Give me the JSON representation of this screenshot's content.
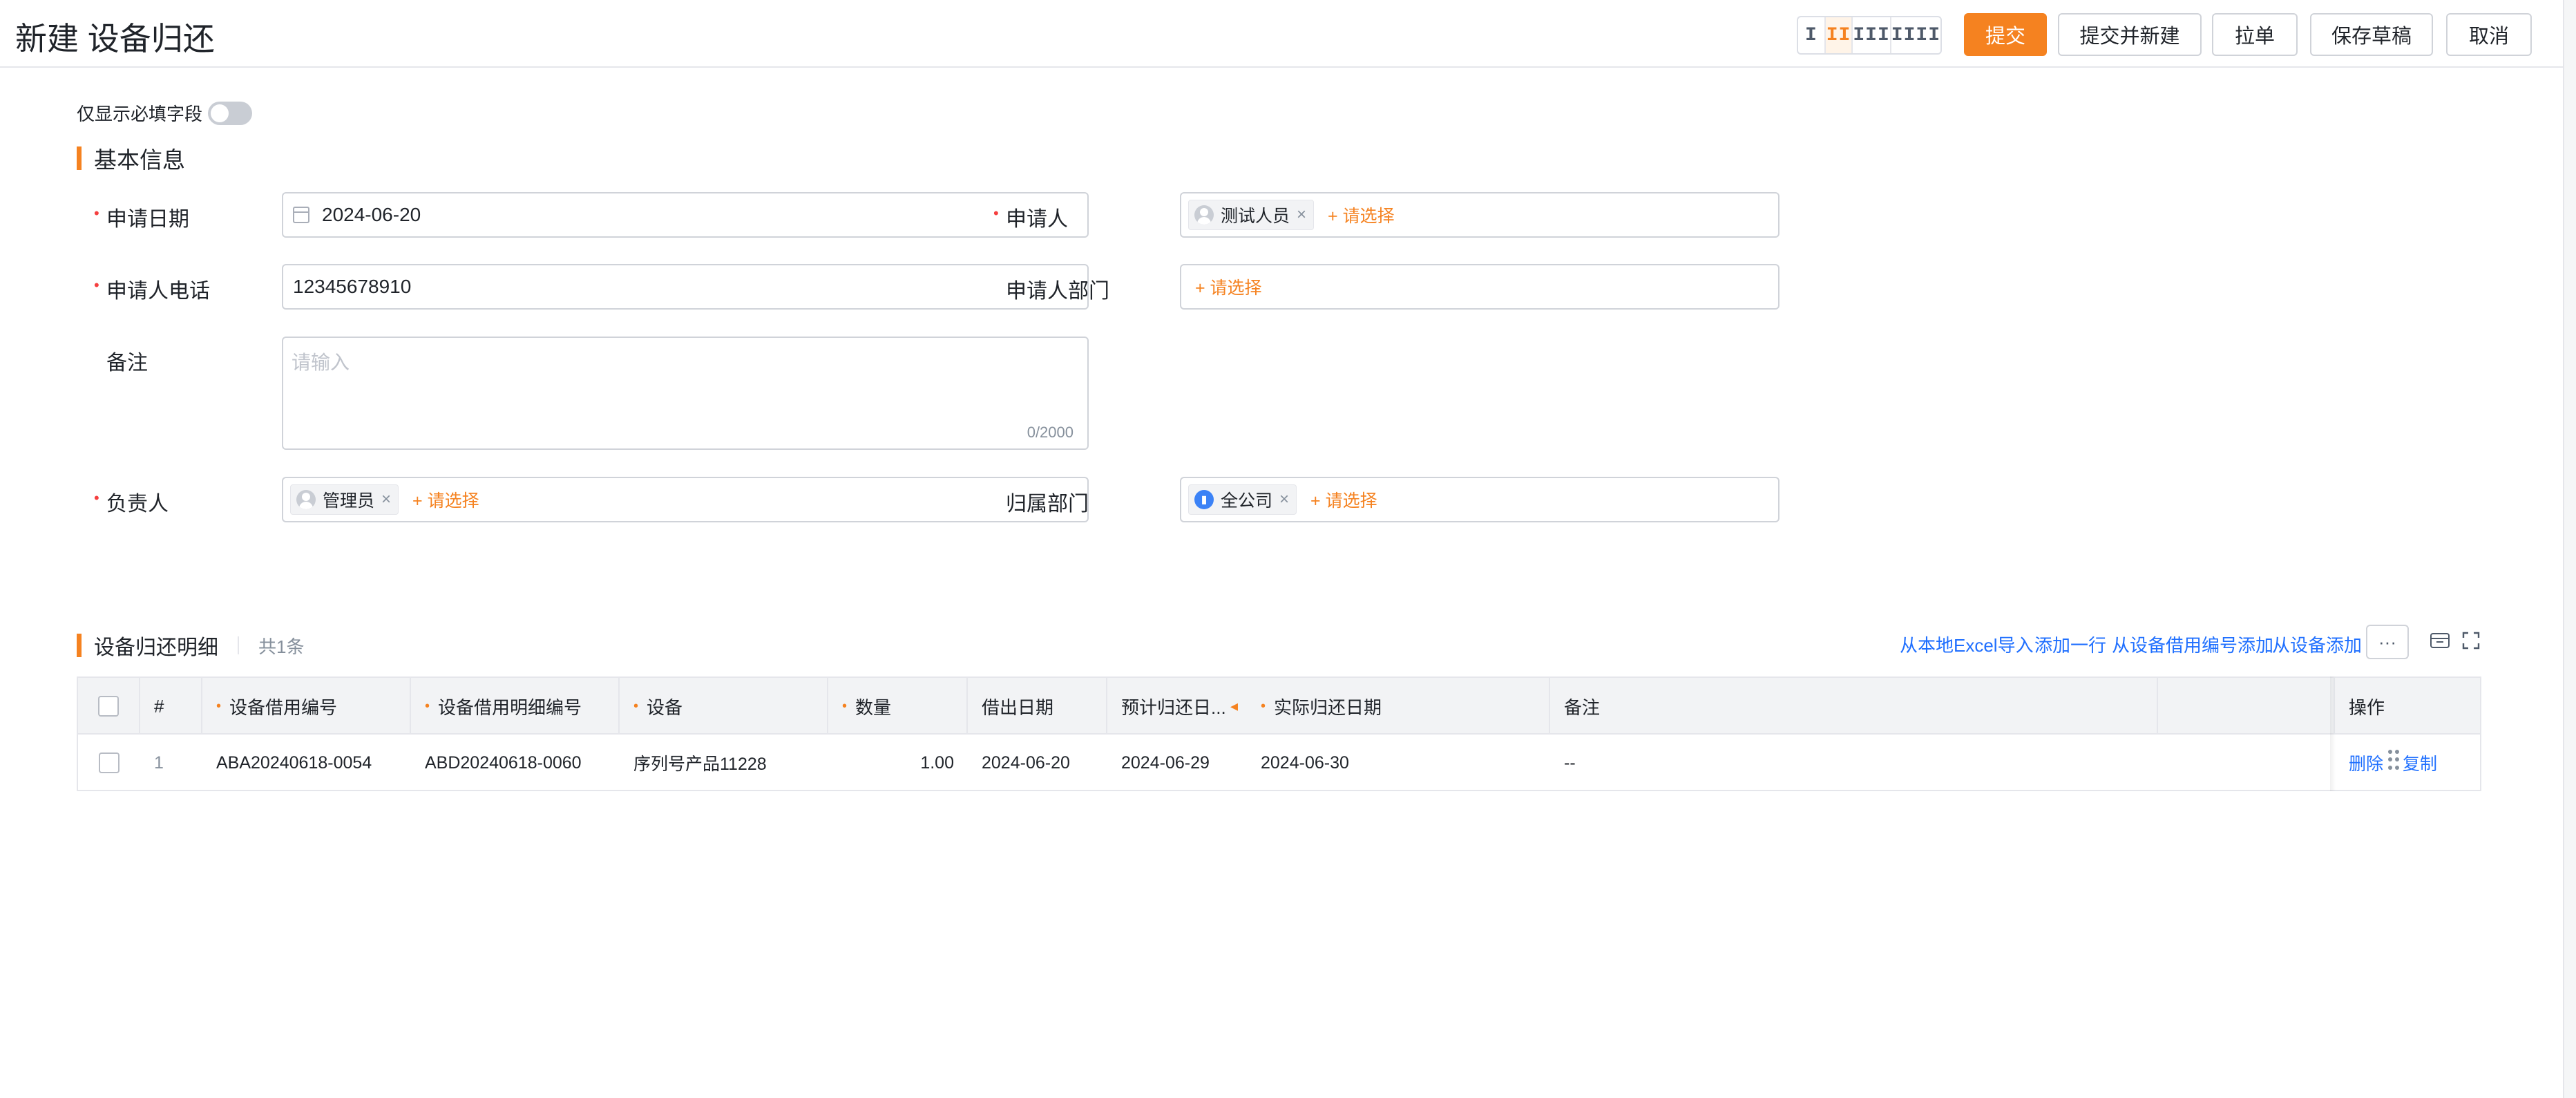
{
  "page": {
    "title": "新建 设备归还"
  },
  "layout_switch": [
    "I",
    "II",
    "III",
    "IIII"
  ],
  "actions": {
    "submit": "提交",
    "submit_new": "提交并新建",
    "pull": "拉单",
    "save_draft": "保存草稿",
    "cancel": "取消"
  },
  "form": {
    "required_only_label": "仅显示必填字段",
    "section_title": "基本信息",
    "apply_date": {
      "label": "申请日期",
      "value": "2024-06-20"
    },
    "applicant": {
      "label": "申请人",
      "tag": "测试人员",
      "add": "+ 请选择"
    },
    "phone": {
      "label": "申请人电话",
      "value": "12345678910"
    },
    "department": {
      "label": "申请人部门",
      "add": "+ 请选择"
    },
    "remark": {
      "label": "备注",
      "placeholder": "请输入",
      "counter": "0/2000"
    },
    "owner": {
      "label": "负责人",
      "tag": "管理员",
      "add": "+ 请选择"
    },
    "belong_dept": {
      "label": "归属部门",
      "tag": "全公司",
      "add": "+ 请选择"
    }
  },
  "detail": {
    "title": "设备归还明细",
    "count": "共1条",
    "links": [
      "从本地Excel导入",
      "添加一行",
      "从设备借用编号添加",
      "从设备添加"
    ],
    "more": "···",
    "columns": [
      "#",
      "设备借用编号",
      "设备借用明细编号",
      "设备",
      "数量",
      "借出日期",
      "预计归还日...",
      "实际归还日期",
      "备注",
      "操作"
    ],
    "rows": [
      {
        "index": "1",
        "borrow_no": "ABA20240618-0054",
        "detail_no": "ABD20240618-0060",
        "device": "序列号产品11228",
        "qty": "1.00",
        "out_date": "2024-06-20",
        "expect_date": "2024-06-29",
        "actual_date": "2024-06-30",
        "remark": "--",
        "ops": [
          "删除",
          "复制"
        ]
      }
    ]
  }
}
